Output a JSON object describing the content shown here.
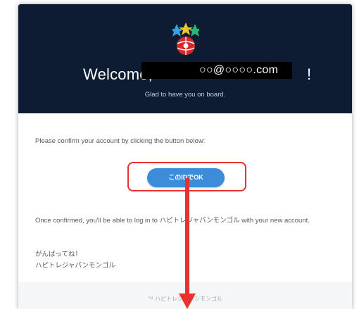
{
  "header": {
    "welcome": "Welcome,",
    "email": "○○@○○○○.com",
    "exclaim": "!",
    "subtitle": "Glad to have you on board."
  },
  "body": {
    "confirm_text": "Please confirm your account by clicking the button below:",
    "button_label": "このIDでOK",
    "once_text": "Once confirmed, you'll be able to log in to ハピトレジャパンモンゴル with your new account.",
    "sign_line1": "がんばってね！",
    "sign_line2": "ハピトレジャパンモンゴル"
  },
  "footer": {
    "text": "™ ハピトレジャパンモンゴル"
  },
  "icons": [
    "logo-icon",
    "down-arrow-icon"
  ],
  "colors": {
    "header_bg": "#0d1b33",
    "button_bg": "#3c8dd9",
    "highlight_border": "#e8322f",
    "arrow": "#e8322f"
  }
}
